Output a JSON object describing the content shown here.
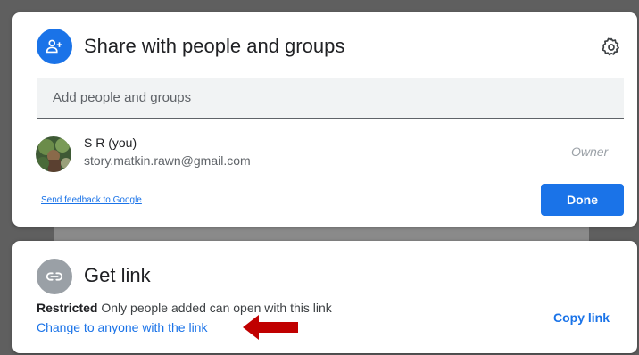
{
  "share_dialog": {
    "title": "Share with people and groups",
    "icons": {
      "header": "person-add-icon",
      "settings": "gear-icon"
    },
    "input": {
      "placeholder": "Add people and groups",
      "value": ""
    },
    "people": [
      {
        "name": "S R (you)",
        "email": "story.matkin.rawn@gmail.com",
        "role": "Owner"
      }
    ],
    "feedback_link": "Send feedback to Google",
    "done_label": "Done"
  },
  "link_dialog": {
    "title": "Get link",
    "icon": "link-icon",
    "access_level": "Restricted",
    "access_description": "Only people added can open with this link",
    "change_link": "Change to anyone with the link",
    "copy_link": "Copy link"
  },
  "annotation": {
    "icon": "red-arrow-icon",
    "color": "#c00000"
  },
  "colors": {
    "accent": "#1a73e8",
    "link_icon_bg": "#9aa0a6",
    "annotation_arrow": "#c00000"
  }
}
